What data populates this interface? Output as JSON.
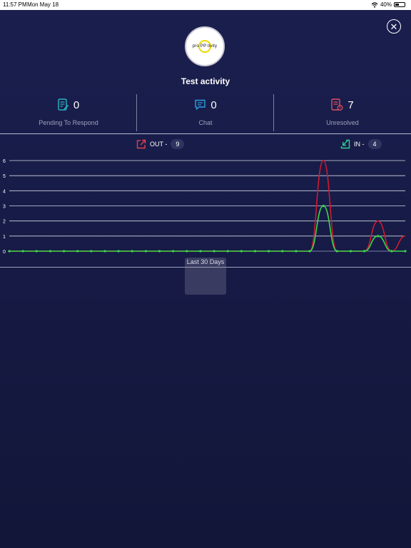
{
  "status_bar": {
    "time": "11:57 PM",
    "date": "Mon May 18",
    "battery": "40%",
    "battery_level": 0.4
  },
  "header": {
    "logo_text": "pro PP tivity",
    "title": "Test activity"
  },
  "stats": [
    {
      "value": "0",
      "label": "Pending To Respond",
      "icon": "document-edit-icon",
      "color": "#2bb3c0"
    },
    {
      "value": "0",
      "label": "Chat",
      "icon": "chat-icon",
      "color": "#2f9ee0"
    },
    {
      "value": "7",
      "label": "Unresolved",
      "icon": "document-alert-icon",
      "color": "#e0505f"
    }
  ],
  "legend": {
    "out": {
      "label": "OUT -",
      "count": "9",
      "icon": "outgoing-arrow-icon",
      "color": "#e0404f"
    },
    "in": {
      "label": "IN -",
      "count": "4",
      "icon": "incoming-arrow-icon",
      "color": "#2ecf8f"
    }
  },
  "range_label": "Last 30 Days",
  "chart_data": {
    "type": "line",
    "y_ticks": [
      "0",
      "1",
      "2",
      "3",
      "4",
      "5",
      "6"
    ],
    "ylim": [
      0,
      6
    ],
    "grid": true,
    "x": [
      1,
      2,
      3,
      4,
      5,
      6,
      7,
      8,
      9,
      10,
      11,
      12,
      13,
      14,
      15,
      16,
      17,
      18,
      19,
      20,
      21,
      22,
      23,
      24,
      25,
      26,
      27,
      28,
      29,
      30
    ],
    "series": [
      {
        "name": "OUT",
        "color": "#d01a2e",
        "values": [
          0,
          0,
          0,
          0,
          0,
          0,
          0,
          0,
          0,
          0,
          0,
          0,
          0,
          0,
          0,
          0,
          0,
          0,
          0,
          0,
          0,
          0,
          0,
          6,
          0,
          0,
          0,
          2,
          0,
          1
        ]
      },
      {
        "name": "IN",
        "color": "#39d84a",
        "values": [
          0,
          0,
          0,
          0,
          0,
          0,
          0,
          0,
          0,
          0,
          0,
          0,
          0,
          0,
          0,
          0,
          0,
          0,
          0,
          0,
          0,
          0,
          0,
          3,
          0,
          0,
          0,
          1,
          0,
          0
        ]
      }
    ]
  }
}
